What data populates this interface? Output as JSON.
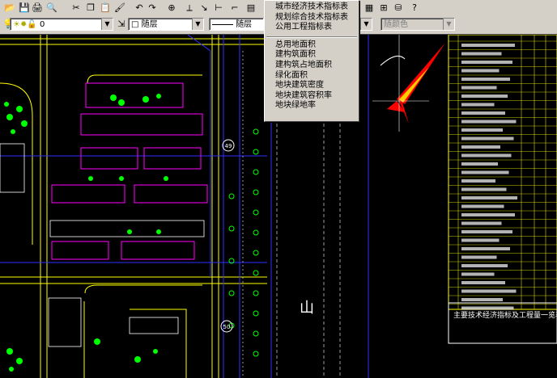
{
  "toolbar": {
    "layer_current": "0",
    "color_value": "□ 随层",
    "linetype_value": "随层",
    "plotstyle_value": "随颜色"
  },
  "dropdown_menu": {
    "group1": [
      "城市经济技术指标表",
      "规划综合技术指标表",
      "公用工程指标表"
    ],
    "group2": [
      "总用地面积",
      "建构筑面积",
      "建构筑占地面积",
      "绿化面积",
      "地块建筑密度",
      "地块建筑容积率",
      "地块绿地率"
    ]
  },
  "drawing": {
    "place_label": "山",
    "table_title": "主要技术经济指标及工程量一览表",
    "circle_marks": [
      "49",
      "50"
    ]
  },
  "colors": {
    "toolbar_bg": "#d4d0c8",
    "canvas_bg": "#000000",
    "cad_yellow": "#ffff00",
    "cad_green": "#00ff00",
    "cad_magenta": "#ff00ff",
    "cad_red": "#ff0000",
    "cad_blue": "#3030ff",
    "cad_white": "#ffffff"
  }
}
